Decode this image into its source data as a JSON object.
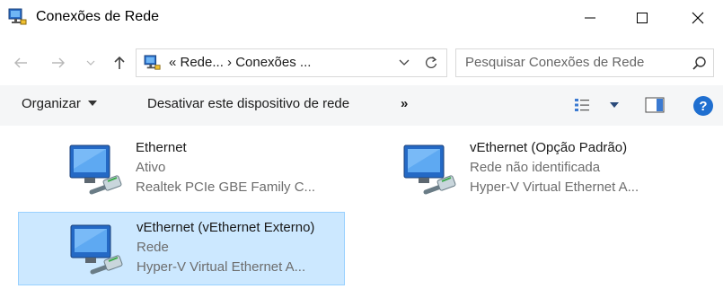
{
  "window": {
    "title": "Conexões de Rede"
  },
  "address": {
    "path": "«  Rede...  ›  Conexões ..."
  },
  "search": {
    "placeholder": "Pesquisar Conexões de Rede"
  },
  "toolbar": {
    "organize_label": "Organizar",
    "disable_label": "Desativar este dispositivo de rede",
    "more_label": "»",
    "help_label": "?"
  },
  "items": [
    {
      "name": "Ethernet",
      "status": "Ativo",
      "device": "Realtek PCIe GBE Family C...",
      "selected": false
    },
    {
      "name": "vEthernet (Opção Padrão)",
      "status": "Rede não identificada",
      "device": "Hyper-V Virtual Ethernet A...",
      "selected": false
    },
    {
      "name": "vEthernet (vEthernet Externo)",
      "status": "Rede",
      "device": "Hyper-V Virtual Ethernet A...",
      "selected": true
    }
  ],
  "colors": {
    "selection_bg": "#cce8ff",
    "selection_border": "#99d1ff",
    "accent": "#1f6fd0"
  }
}
